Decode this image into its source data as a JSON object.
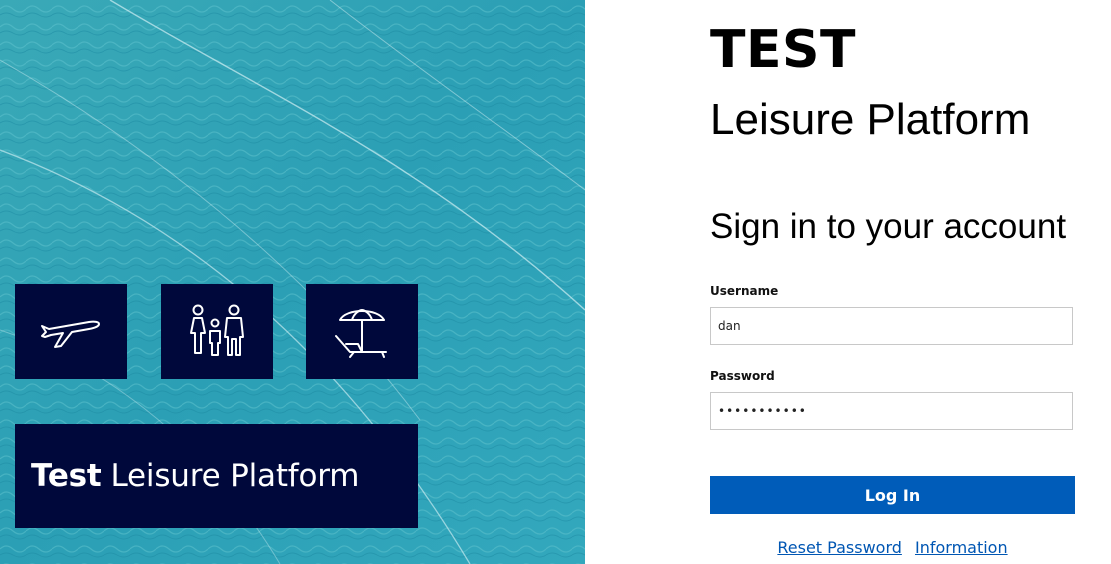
{
  "hero": {
    "background_color": "#2ea6b8",
    "tile_color": "#00083b",
    "tiles": [
      {
        "icon": "airplane-icon"
      },
      {
        "icon": "family-icon"
      },
      {
        "icon": "beach-umbrella-icon"
      }
    ],
    "brand": {
      "bold": "Test",
      "rest": "Leisure Platform"
    }
  },
  "login": {
    "logo_title": "TEST",
    "logo_subtitle": "Leisure Platform",
    "heading": "Sign in to your account",
    "username": {
      "label": "Username",
      "value": "dan"
    },
    "password": {
      "label": "Password",
      "value": "•••••••••••"
    },
    "submit_label": "Log In",
    "submit_color": "#005cb9",
    "links": {
      "reset_password": "Reset Password",
      "information": "Information"
    }
  }
}
